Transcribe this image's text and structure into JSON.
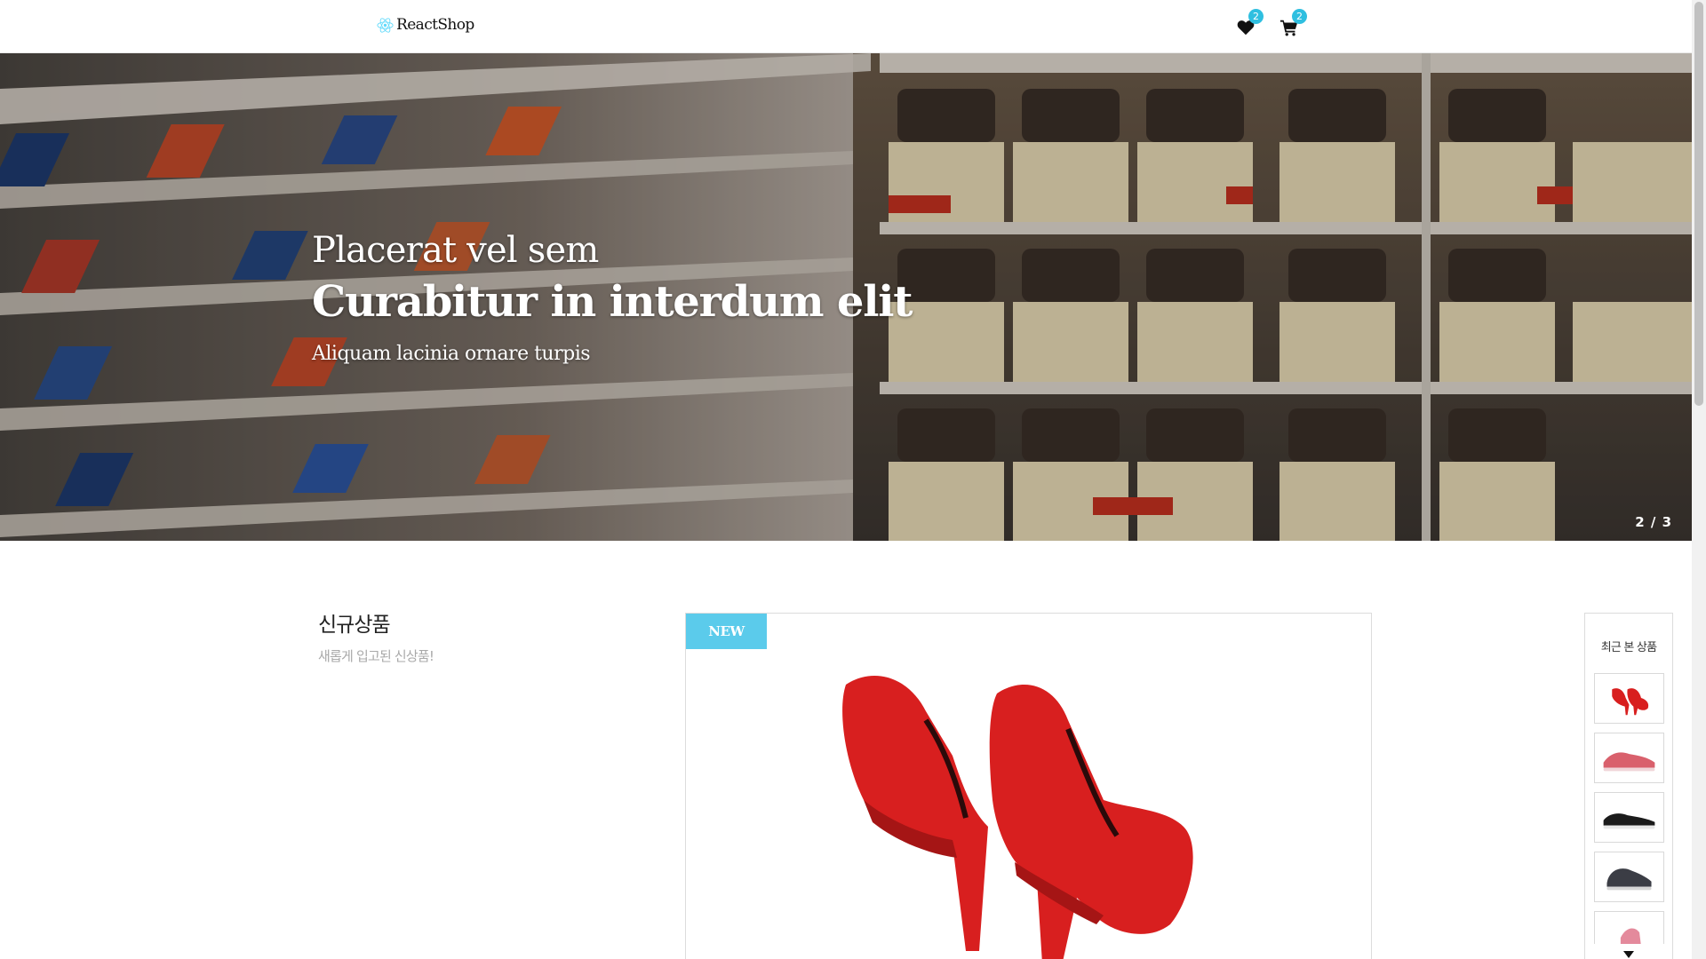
{
  "header": {
    "logo_text": "ReactShop",
    "wishlist_count": "2",
    "cart_count": "2",
    "icons": {
      "logo": "react-atom-icon",
      "wishlist": "heart-icon",
      "cart": "cart-icon"
    },
    "badge_color": "#2fbfe0"
  },
  "hero": {
    "subtitle": "Placerat vel sem",
    "title": "Curabitur in interdum elit",
    "description": "Aliquam lacinia ornare turpis",
    "slide_counter": "2 / 3",
    "current_slide": 2,
    "total_slides": 3
  },
  "new_products": {
    "title": "신규상품",
    "subtitle": "새롭게 입고된 신상품!",
    "featured_tag": "NEW",
    "tag_color": "#5bcbeb"
  },
  "recent": {
    "title": "최근 본 상품",
    "down_icon": "caret-down-icon"
  }
}
